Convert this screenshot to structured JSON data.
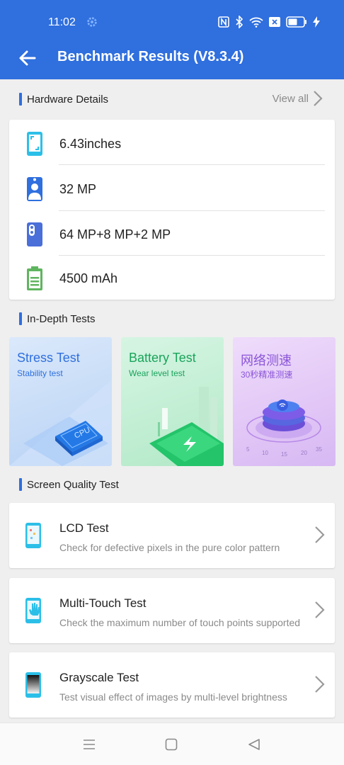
{
  "status_bar": {
    "time": "11:02",
    "icons": [
      "gear-icon",
      "nfc-icon",
      "bluetooth-icon",
      "wifi-icon",
      "sim-off-icon",
      "battery-icon",
      "charging-icon"
    ]
  },
  "app_bar": {
    "title": "Benchmark Results (V8.3.4)",
    "back_icon": "arrow-left-icon"
  },
  "hardware": {
    "title": "Hardware Details",
    "view_all": "View all",
    "items": [
      {
        "icon": "screen-size-icon",
        "value": "6.43inches"
      },
      {
        "icon": "front-camera-icon",
        "value": "32 MP"
      },
      {
        "icon": "rear-camera-icon",
        "value": "64 MP+8 MP+2 MP"
      },
      {
        "icon": "battery-capacity-icon",
        "value": "4500 mAh"
      }
    ]
  },
  "in_depth": {
    "title": "In-Depth Tests",
    "tiles": [
      {
        "title": "Stress Test",
        "subtitle": "Stability test",
        "chip_label": "CPU"
      },
      {
        "title": "Battery Test",
        "subtitle": "Wear level test"
      },
      {
        "title": "网络测速",
        "subtitle": "30秒精准测速",
        "scale": [
          "5",
          "10",
          "15",
          "20",
          "35"
        ]
      }
    ]
  },
  "screen_quality": {
    "title": "Screen Quality Test",
    "items": [
      {
        "title": "LCD Test",
        "desc": "Check for defective pixels in the pure color pattern",
        "icon": "lcd-test-icon"
      },
      {
        "title": "Multi-Touch Test",
        "desc": "Check the maximum number of touch points supported",
        "icon": "multi-touch-icon"
      },
      {
        "title": "Grayscale Test",
        "desc": "Test visual effect of images by multi-level brightness",
        "icon": "grayscale-icon"
      }
    ]
  },
  "colors": {
    "primary": "#2f6fde",
    "accent_cyan": "#2bbfe8",
    "battery_green": "#5fb55f"
  },
  "nav": {
    "icons": [
      "menu-icon",
      "home-icon",
      "back-triangle-icon"
    ]
  }
}
